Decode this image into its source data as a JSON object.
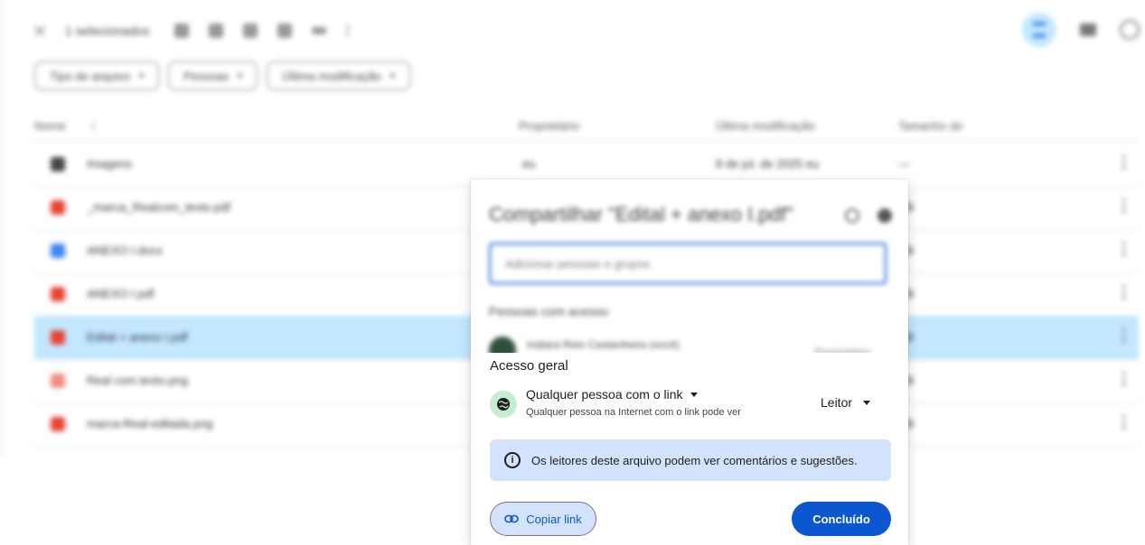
{
  "toolbar": {
    "selection_text": "1 selecionados"
  },
  "filters": [
    {
      "label": "Tipo de arquivo"
    },
    {
      "label": "Pessoas"
    },
    {
      "label": "Última modificação"
    }
  ],
  "table": {
    "col_name": "Nome",
    "col_owner": "Proprietário",
    "col_modified": "Última modificação",
    "col_size": "Tamanho do",
    "rows": [
      {
        "name": "Imagens",
        "owner": "eu",
        "modified": "8 de jul. de 2025 eu",
        "size": "—",
        "icon_color": "#444746"
      },
      {
        "name": "_marca_Realcom_texto.pdf",
        "owner": "",
        "modified": "",
        "size": "KB",
        "icon_color": "#ea4335"
      },
      {
        "name": "ANEXO I.docx",
        "owner": "",
        "modified": "",
        "size": "KB",
        "icon_color": "#4285f4"
      },
      {
        "name": "ANEXO I.pdf",
        "owner": "",
        "modified": "",
        "size": "KB",
        "icon_color": "#ea4335"
      },
      {
        "name": "Edital + anexo I.pdf",
        "owner": "",
        "modified": "",
        "size": "KB",
        "icon_color": "#ea4335",
        "selected": true
      },
      {
        "name": "Real com texto.png",
        "owner": "",
        "modified": "",
        "size": "KB",
        "icon_color": "#f28b82"
      },
      {
        "name": "marca-Real-editada.png",
        "owner": "",
        "modified": "",
        "size": "KB",
        "icon_color": "#ea4335"
      }
    ]
  },
  "dialog": {
    "title": "Compartilhar \"Edital + anexo I.pdf\"",
    "input_placeholder": "Adicionar pessoas e grupos",
    "people_title": "Pessoas com acesso",
    "owner_name": "Indiara Reis Castanheira (você)",
    "owner_role": "Proprietário",
    "general_access_title": "Acesso geral",
    "access_mode": "Qualquer pessoa com o link",
    "access_description": "Qualquer pessoa na Internet com o link pode ver",
    "access_role": "Leitor",
    "info_text": "Os leitores deste arquivo podem ver comentários e sugestões.",
    "copy_link_label": "Copiar link",
    "done_label": "Concluído"
  },
  "colors": {
    "accent": "#0b57d0",
    "banner": "#d3e3fd",
    "globe_badge": "#c4eed0",
    "selected_row": "#c2e7ff"
  },
  "icons": [
    "close-icon",
    "add-person-icon",
    "download-icon",
    "move-icon",
    "trash-icon",
    "link-icon",
    "more-icon",
    "filter-icon",
    "grid-icon",
    "info-icon",
    "globe-icon",
    "help-icon",
    "settings-icon"
  ]
}
